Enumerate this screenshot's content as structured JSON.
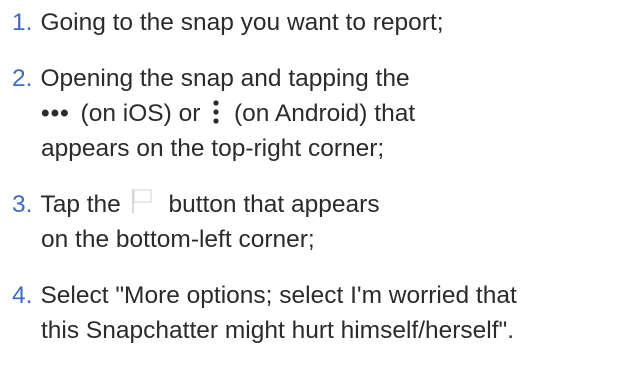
{
  "steps": [
    {
      "number": "1.",
      "lines": [
        "Going to the snap you want to report;"
      ]
    },
    {
      "number": "2.",
      "line1": "Opening the snap and tapping the",
      "line2_dots_h": "•••",
      "line2_part1": "(on iOS) or",
      "line2_part2": "(on Android) that",
      "line3": "appears on the top-right corner;"
    },
    {
      "number": "3.",
      "line1_part1": "Tap the",
      "line1_part2": "button that appears",
      "line2": "on the bottom-left corner;"
    },
    {
      "number": "4.",
      "line1": "Select \"More options; select I'm worried that",
      "line2": "this Snapchatter might hurt himself/herself\"."
    }
  ],
  "icons": {
    "ios_menu": "more-horizontal-icon",
    "android_menu": "more-vertical-icon",
    "report": "flag-icon"
  },
  "colors": {
    "number": "#3b6cc4",
    "text": "#2b2b2b",
    "flag": "#d9d9d9"
  }
}
